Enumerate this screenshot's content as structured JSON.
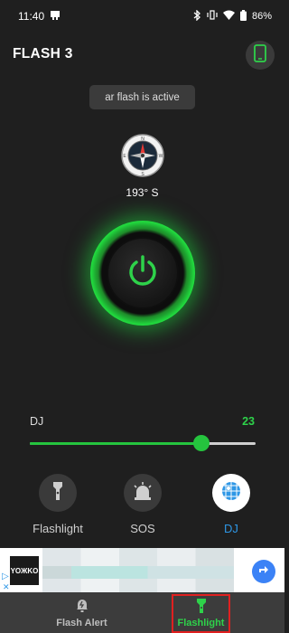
{
  "status_bar": {
    "time": "11:40",
    "battery": "86%",
    "icons": [
      "notification-icon",
      "bluetooth-icon",
      "vibrate-icon",
      "wifi-icon",
      "battery-icon"
    ]
  },
  "app": {
    "title": "FLASH 3",
    "toast": "ar flash is active"
  },
  "compass": {
    "heading": "193° S"
  },
  "dj": {
    "label": "DJ",
    "value": "23",
    "level_percent": 76
  },
  "modes": [
    {
      "label": "Flashlight",
      "icon": "flashlight-icon",
      "active": false
    },
    {
      "label": "SOS",
      "icon": "siren-icon",
      "active": false
    },
    {
      "label": "DJ",
      "icon": "disco-ball-icon",
      "active": true
    }
  ],
  "ad": {
    "logo_text": "YOЖKO"
  },
  "bottom_nav": [
    {
      "label": "Flash Alert",
      "icon": "bell-flash-icon",
      "active": false
    },
    {
      "label": "Flashlight",
      "icon": "flashlight-icon",
      "active": true
    }
  ],
  "colors": {
    "accent_green": "#2ed24a",
    "accent_blue": "#2e97e6",
    "background": "#1f1f1f"
  }
}
